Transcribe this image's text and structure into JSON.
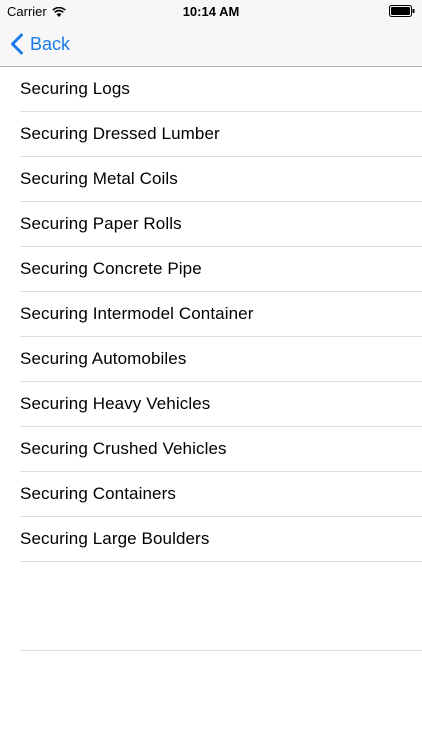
{
  "status_bar": {
    "carrier": "Carrier",
    "time": "10:14 AM",
    "wifi_icon": "wifi-icon",
    "battery_icon": "battery-icon"
  },
  "nav_bar": {
    "back_label": "Back",
    "back_icon": "chevron-left-icon",
    "tint_color": "#1a7bea"
  },
  "list": {
    "items": [
      {
        "label": "Securing Logs"
      },
      {
        "label": "Securing Dressed Lumber"
      },
      {
        "label": "Securing Metal Coils"
      },
      {
        "label": "Securing Paper Rolls"
      },
      {
        "label": "Securing Concrete Pipe"
      },
      {
        "label": "Securing Intermodel Container"
      },
      {
        "label": "Securing Automobiles"
      },
      {
        "label": "Securing Heavy Vehicles"
      },
      {
        "label": "Securing Crushed Vehicles"
      },
      {
        "label": "Securing Containers"
      },
      {
        "label": "Securing Large Boulders"
      }
    ]
  }
}
